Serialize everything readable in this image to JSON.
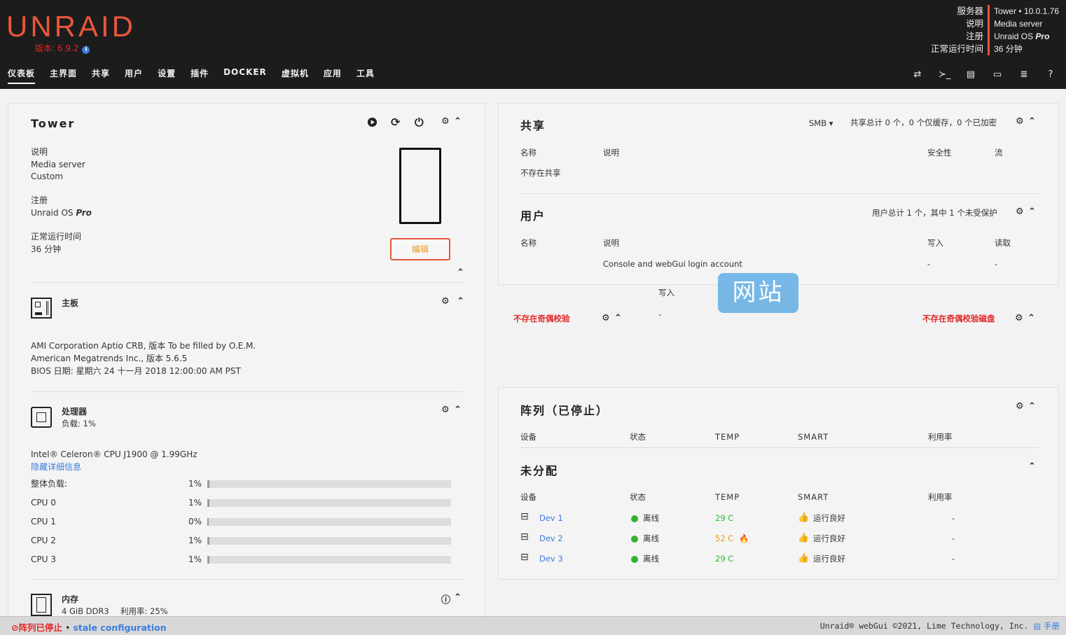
{
  "app": {
    "logo": "UNRAID",
    "version": "版本: 6.9.2"
  },
  "server": {
    "labels": [
      "服务器",
      "说明",
      "注册",
      "正常运行时间"
    ],
    "name": "Tower • 10.0.1.76",
    "description": "Media server",
    "registration_prefix": "Unraid OS ",
    "registration_edition": "Pro",
    "uptime": "36 分钟"
  },
  "nav": {
    "items": [
      "仪表板",
      "主界面",
      "共享",
      "用户",
      "设置",
      "插件",
      "DOCKER",
      "虚拟机",
      "应用",
      "工具"
    ],
    "active": "仪表板"
  },
  "tower": {
    "title": "Tower",
    "desc_label": "说明",
    "desc_line1": "Media server",
    "desc_line2": "Custom",
    "reg_label": "注册",
    "reg_prefix": "Unraid OS ",
    "reg_edition": "Pro",
    "uptime_label": "正常运行时间",
    "uptime": "36 分钟",
    "edit_button": "编辑"
  },
  "mobo": {
    "title": "主板",
    "line1": "AMI Corporation Aptio CRB, 版本 To be filled by O.E.M.",
    "line2": "American Megatrends Inc., 版本 5.6.5",
    "line3": "BIOS 日期: 星期六 24 十一月 2018 12:00:00 AM PST"
  },
  "cpu": {
    "title": "处理器",
    "load": "负载: 1%",
    "model": "Intel® Celeron® CPU J1900 @ 1.99GHz",
    "hide_details": "隐藏详细信息",
    "rows": [
      {
        "label": "整体负载:",
        "value": "1%",
        "pct": 1
      },
      {
        "label": "CPU 0",
        "value": "1%",
        "pct": 1
      },
      {
        "label": "CPU 1",
        "value": "0%",
        "pct": 0
      },
      {
        "label": "CPU 2",
        "value": "1%",
        "pct": 1
      },
      {
        "label": "CPU 3",
        "value": "1%",
        "pct": 1
      }
    ]
  },
  "memory": {
    "title": "内存",
    "size": "4 GiB DDR3",
    "usage": "利用率: 25%"
  },
  "shares": {
    "title": "共享",
    "protocol": "SMB",
    "summary": "共享总计 0 个，0 个仅缓存，0 个已加密",
    "cols": [
      "名称",
      "说明",
      "安全性",
      "流"
    ],
    "empty": "不存在共享"
  },
  "users": {
    "title": "用户",
    "summary": "用户总计 1 个，其中 1 个未受保护",
    "cols": [
      "名称",
      "说明",
      "写入",
      "读取"
    ],
    "row": {
      "desc": "Console and webGui login account",
      "write": "-",
      "read": "-"
    },
    "ghost_write": "写入",
    "ghost_dash": "-"
  },
  "parity": {
    "left_title": "不存在奇偶校验",
    "right_title": "不存在奇偶校验磁盘"
  },
  "array": {
    "title": "阵列（已停止）",
    "cols": [
      "设备",
      "状态",
      "TEMP",
      "SMART",
      "利用率"
    ]
  },
  "unassigned": {
    "title": "未分配",
    "cols": [
      "设备",
      "状态",
      "TEMP",
      "SMART",
      "利用率"
    ],
    "rows": [
      {
        "name": "Dev 1",
        "status": "离线",
        "temp": "29 C",
        "smart": "运行良好",
        "util": "-"
      },
      {
        "name": "Dev 2",
        "status": "离线",
        "temp": "52 C",
        "smart": "运行良好",
        "util": "-"
      },
      {
        "name": "Dev 3",
        "status": "离线",
        "temp": "29 C",
        "smart": "运行良好",
        "util": "-"
      }
    ]
  },
  "footer": {
    "stopped": "阵列已停止",
    "sep": " • ",
    "stale": "stale configuration",
    "copyright": "Unraid® webGui ©2021, Lime Technology, Inc.",
    "manual": "手册"
  },
  "watermark": {
    "text": "网站"
  },
  "colors": {
    "accent": "#e8563a",
    "link": "#3b7ddd",
    "ok": "#33b233",
    "warn": "#e89a1a",
    "error": "#e22828"
  }
}
